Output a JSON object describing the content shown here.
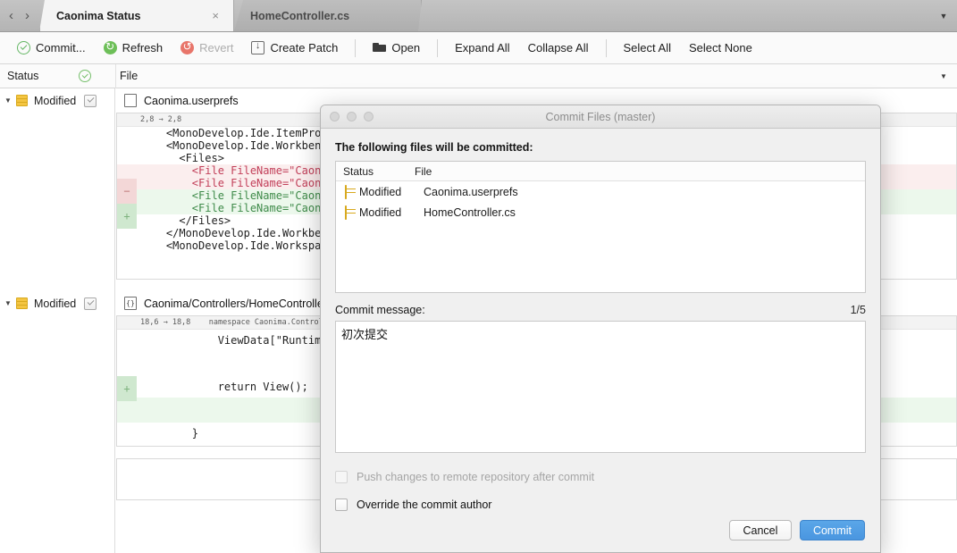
{
  "tabbar": {
    "back_icon": "‹",
    "forward_icon": "›",
    "tabs": [
      {
        "label": "Caonima Status",
        "active": true,
        "close_icon": "×"
      },
      {
        "label": "HomeController.cs",
        "active": false
      }
    ],
    "overflow_icon": "▼"
  },
  "toolbar": {
    "commit": "Commit...",
    "refresh": "Refresh",
    "revert": "Revert",
    "create_patch": "Create Patch",
    "open": "Open",
    "expand_all": "Expand All",
    "collapse_all": "Collapse All",
    "select_all": "Select All",
    "select_none": "Select None"
  },
  "columns": {
    "status": "Status",
    "file": "File",
    "menu_icon": "▼",
    "check_icon": "check-circle"
  },
  "rows": [
    {
      "status": "Modified",
      "twisty": "▼",
      "file": "Caonima.userprefs",
      "file_icon": "blank-file-icon",
      "hunk": "2,8 → 2,8",
      "lines": [
        {
          "type": "ctx",
          "text": "    <MonoDevelop.Ide.ItemProper"
        },
        {
          "type": "ctx",
          "text": "    <MonoDevelop.Ide.Workbench"
        },
        {
          "type": "ctx",
          "text": "      <Files>"
        },
        {
          "type": "del",
          "text": "        <File FileName=\"Caonima"
        },
        {
          "type": "del",
          "text": "        <File FileName=\"Caonima"
        },
        {
          "type": "add",
          "text": "        <File FileName=\"Caonima"
        },
        {
          "type": "add",
          "text": "        <File FileName=\"Caonima"
        },
        {
          "type": "ctx",
          "text": "      </Files>"
        },
        {
          "type": "ctx",
          "text": "    </MonoDevelop.Ide.Workbench"
        },
        {
          "type": "ctx",
          "text": "    <MonoDevelop.Ide.Workspace"
        }
      ]
    },
    {
      "status": "Modified",
      "twisty": "▼",
      "file": "Caonima/Controllers/HomeControlle",
      "file_icon": "cs-file-icon",
      "hunk": "18,6 → 18,8    namespace Caonima.Controlle",
      "lines": [
        {
          "type": "ctx",
          "text": "            ViewData[\"Runtime"
        },
        {
          "type": "ctx",
          "text": ""
        },
        {
          "type": "ctx",
          "text": "            return View();"
        },
        {
          "type": "add",
          "text": ""
        },
        {
          "type": "ctx",
          "text": "        }"
        }
      ]
    }
  ],
  "dialog": {
    "title": "Commit Files (master)",
    "lights": [
      "close",
      "minimize",
      "zoom"
    ],
    "intro": "The following files will be committed:",
    "filelist": {
      "headers": [
        "Status",
        "File"
      ],
      "rows": [
        {
          "status": "Modified",
          "file": "Caonima.userprefs"
        },
        {
          "status": "Modified",
          "file": "HomeController.cs"
        }
      ]
    },
    "commit_message_label": "Commit message:",
    "commit_message_count": "1/5",
    "commit_message_value": "初次提交",
    "commit_message_placeholder": "",
    "push_checkbox_label": "Push changes to remote repository after commit",
    "override_checkbox_label": "Override the commit author",
    "cancel_button": "Cancel",
    "commit_button": "Commit"
  },
  "colors": {
    "accent": "#4a96e0",
    "modified": "#f4c542",
    "add": "#ecf8ec",
    "del": "#fbeeee"
  }
}
